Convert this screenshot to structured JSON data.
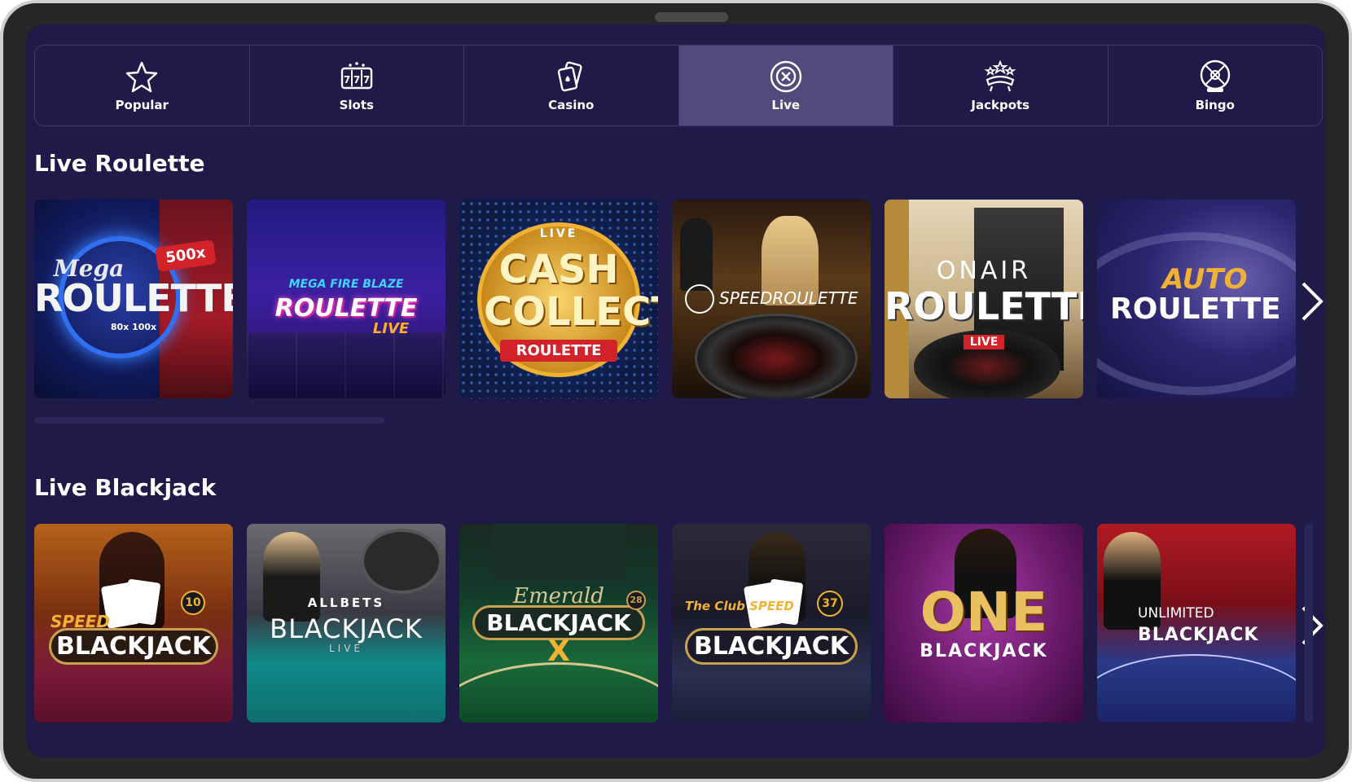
{
  "nav": {
    "items": [
      {
        "label": "Popular",
        "icon": "star-icon",
        "active": false
      },
      {
        "label": "Slots",
        "icon": "slot-machine-icon",
        "active": false
      },
      {
        "label": "Casino",
        "icon": "cards-icon",
        "active": false
      },
      {
        "label": "Live",
        "icon": "roulette-chip-icon",
        "active": true
      },
      {
        "label": "Jackpots",
        "icon": "crown-icon",
        "active": false
      },
      {
        "label": "Bingo",
        "icon": "bingo-ball-icon",
        "active": false
      }
    ]
  },
  "sections": {
    "roulette": {
      "title": "Live Roulette",
      "games": [
        {
          "prefix": "Mega",
          "title": "ROULETTE",
          "badge": "500x",
          "extra": "80x  100x"
        },
        {
          "prefix": "MEGA FIRE BLAZE",
          "title": "ROULETTE",
          "suffix": "LIVE"
        },
        {
          "prefix": "LIVE",
          "title": "CASH COLLECT",
          "suffix": "ROULETTE"
        },
        {
          "prefix": "",
          "title": "SPEEDROULETTE"
        },
        {
          "prefix": "ONAIR",
          "title": "ROULETTE",
          "suffix": "LIVE"
        },
        {
          "prefix": "AUTO",
          "title": "ROULETTE"
        }
      ]
    },
    "blackjack": {
      "title": "Live Blackjack",
      "games": [
        {
          "prefix": "SPEED",
          "title": "BLACKJACK",
          "badge": "10"
        },
        {
          "prefix": "ALLBETS",
          "title": "BLACKJACK",
          "suffix": "LIVE"
        },
        {
          "prefix": "Emerald",
          "title": "BLACKJACK",
          "badge": "28"
        },
        {
          "prefix": "The Club SPEED",
          "title": "BLACKJACK",
          "badge": "37"
        },
        {
          "prefix": "ONE",
          "title": "BLACKJACK"
        },
        {
          "prefix": "UNLIMITED",
          "title": "BLACKJACK"
        }
      ]
    }
  },
  "colors": {
    "background": "#1f1a48",
    "nav_active": "#514a7c",
    "accent_gold": "#f1b233",
    "live_red": "#d3232a"
  }
}
